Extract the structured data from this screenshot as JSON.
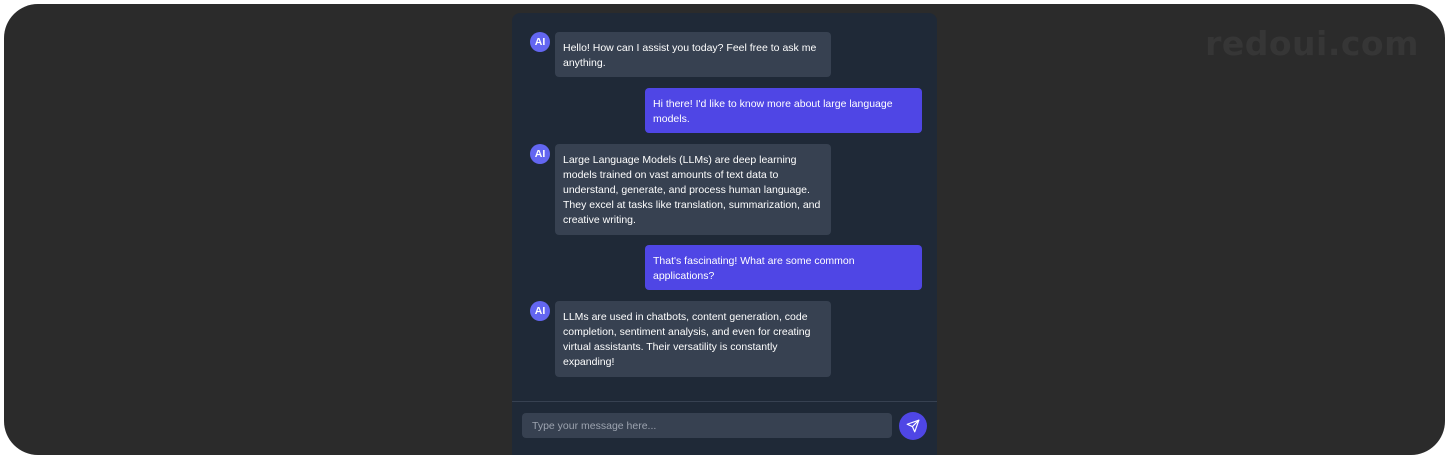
{
  "watermark": "redoui.com",
  "chat": {
    "avatar_label": "AI",
    "messages": [
      {
        "role": "ai",
        "text": "Hello! How can I assist you today? Feel free to ask me anything."
      },
      {
        "role": "user",
        "text": "Hi there! I'd like to know more about large language models."
      },
      {
        "role": "ai",
        "text": "Large Language Models (LLMs) are deep learning models trained on vast amounts of text data to understand, generate, and process human language. They excel at tasks like translation, summarization, and creative writing."
      },
      {
        "role": "user",
        "text": "That's fascinating! What are some common applications?"
      },
      {
        "role": "ai",
        "text": "LLMs are used in chatbots, content generation, code completion, sentiment analysis, and even for creating virtual assistants. Their versatility is constantly expanding!"
      }
    ],
    "input": {
      "placeholder": "Type your message here...",
      "value": ""
    },
    "send_icon": "send-icon",
    "colors": {
      "panel": "#1f2937",
      "ai_bubble": "#374151",
      "user_bubble": "#4f46e5",
      "avatar": "#6366f1"
    }
  }
}
